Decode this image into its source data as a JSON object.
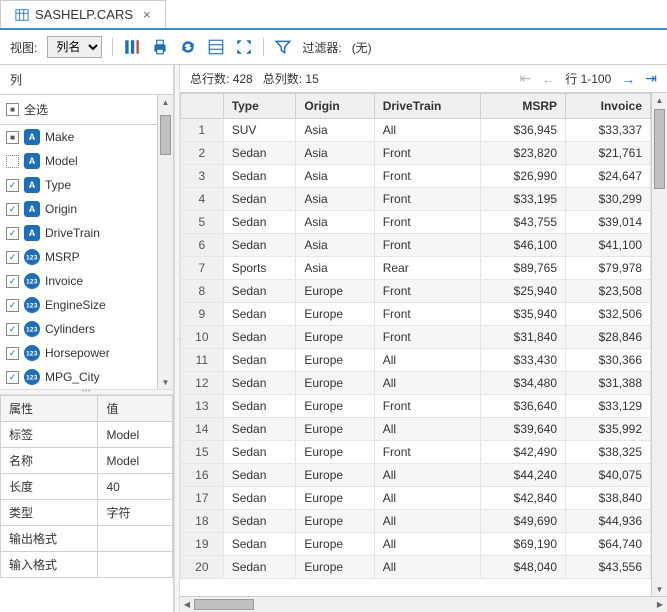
{
  "tab": {
    "title": "SASHELP.CARS"
  },
  "toolbar": {
    "view_label": "视图:",
    "view_value": "列名",
    "filter_label": "过滤器:",
    "filter_value": "(无)"
  },
  "sidebar": {
    "columns_header": "列",
    "select_all": "全选",
    "columns": [
      {
        "name": "Make",
        "type": "char",
        "checked": false,
        "check_style": "box"
      },
      {
        "name": "Model",
        "type": "char",
        "checked": false,
        "check_style": "dotted"
      },
      {
        "name": "Type",
        "type": "char",
        "checked": true
      },
      {
        "name": "Origin",
        "type": "char",
        "checked": true
      },
      {
        "name": "DriveTrain",
        "type": "char",
        "checked": true
      },
      {
        "name": "MSRP",
        "type": "num",
        "checked": true
      },
      {
        "name": "Invoice",
        "type": "num",
        "checked": true
      },
      {
        "name": "EngineSize",
        "type": "num",
        "checked": true
      },
      {
        "name": "Cylinders",
        "type": "num",
        "checked": true
      },
      {
        "name": "Horsepower",
        "type": "num",
        "checked": true
      },
      {
        "name": "MPG_City",
        "type": "num",
        "checked": true
      }
    ],
    "props": {
      "header_attr": "属性",
      "header_val": "值",
      "rows": [
        {
          "k": "标签",
          "v": "Model"
        },
        {
          "k": "名称",
          "v": "Model"
        },
        {
          "k": "长度",
          "v": "40"
        },
        {
          "k": "类型",
          "v": "字符"
        },
        {
          "k": "输出格式",
          "v": ""
        },
        {
          "k": "输入格式",
          "v": ""
        }
      ]
    }
  },
  "data": {
    "total_rows_label": "总行数:",
    "total_rows": 428,
    "total_cols_label": "总列数:",
    "total_cols": 15,
    "range_label": "行 1-100",
    "headers": [
      "Type",
      "Origin",
      "DriveTrain",
      "MSRP",
      "Invoice"
    ],
    "num_cols": [
      3,
      4
    ],
    "rows": [
      [
        "SUV",
        "Asia",
        "All",
        "$36,945",
        "$33,337"
      ],
      [
        "Sedan",
        "Asia",
        "Front",
        "$23,820",
        "$21,761"
      ],
      [
        "Sedan",
        "Asia",
        "Front",
        "$26,990",
        "$24,647"
      ],
      [
        "Sedan",
        "Asia",
        "Front",
        "$33,195",
        "$30,299"
      ],
      [
        "Sedan",
        "Asia",
        "Front",
        "$43,755",
        "$39,014"
      ],
      [
        "Sedan",
        "Asia",
        "Front",
        "$46,100",
        "$41,100"
      ],
      [
        "Sports",
        "Asia",
        "Rear",
        "$89,765",
        "$79,978"
      ],
      [
        "Sedan",
        "Europe",
        "Front",
        "$25,940",
        "$23,508"
      ],
      [
        "Sedan",
        "Europe",
        "Front",
        "$35,940",
        "$32,506"
      ],
      [
        "Sedan",
        "Europe",
        "Front",
        "$31,840",
        "$28,846"
      ],
      [
        "Sedan",
        "Europe",
        "All",
        "$33,430",
        "$30,366"
      ],
      [
        "Sedan",
        "Europe",
        "All",
        "$34,480",
        "$31,388"
      ],
      [
        "Sedan",
        "Europe",
        "Front",
        "$36,640",
        "$33,129"
      ],
      [
        "Sedan",
        "Europe",
        "All",
        "$39,640",
        "$35,992"
      ],
      [
        "Sedan",
        "Europe",
        "Front",
        "$42,490",
        "$38,325"
      ],
      [
        "Sedan",
        "Europe",
        "All",
        "$44,240",
        "$40,075"
      ],
      [
        "Sedan",
        "Europe",
        "All",
        "$42,840",
        "$38,840"
      ],
      [
        "Sedan",
        "Europe",
        "All",
        "$49,690",
        "$44,936"
      ],
      [
        "Sedan",
        "Europe",
        "All",
        "$69,190",
        "$64,740"
      ],
      [
        "Sedan",
        "Europe",
        "All",
        "$48,040",
        "$43,556"
      ]
    ]
  }
}
